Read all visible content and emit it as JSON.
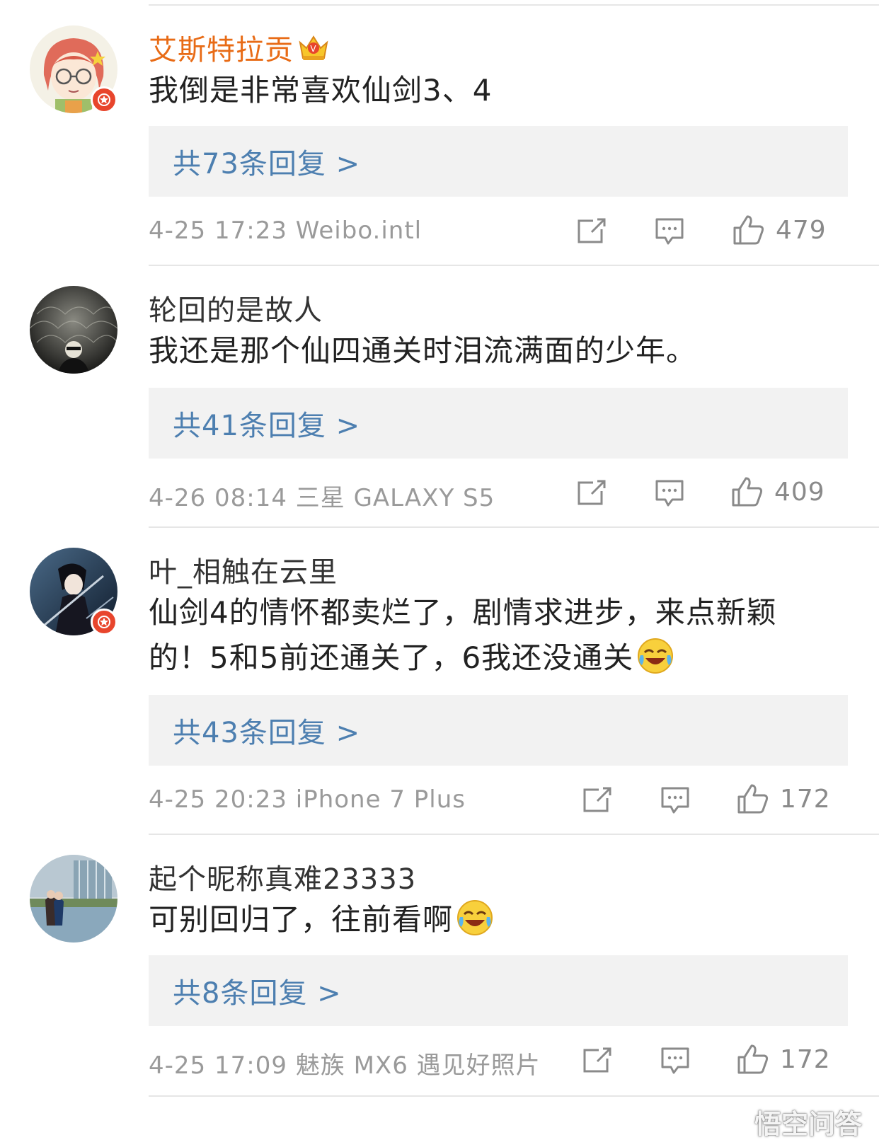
{
  "comments": [
    {
      "username": "艾斯特拉贡",
      "text": "我倒是非常喜欢仙剑3、4",
      "text_line2": "",
      "replies_label": "共73条回复 >",
      "meta": "4-25 17:23 Weibo.intl",
      "likes": "479"
    },
    {
      "username": "轮回的是故人",
      "text": "我还是那个仙四通关时泪流满面的少年。",
      "text_line2": "",
      "replies_label": "共41条回复 >",
      "meta": "4-26 08:14  三星 GALAXY S5",
      "likes": "409"
    },
    {
      "username": "叶_相触在云里",
      "text": "仙剑4的情怀都卖烂了，剧情求进步，来点新颖",
      "text_line2": "的！5和5前还通关了，6我还没通关",
      "replies_label": "共43条回复 >",
      "meta": "4-25 20:23 iPhone 7 Plus",
      "likes": "172"
    },
    {
      "username": "起个昵称真难23333",
      "text": "可别回归了，往前看啊",
      "text_line2": "",
      "replies_label": "共8条回复 >",
      "meta": "4-25 17:09 魅族 MX6 遇见好照片",
      "likes": "172"
    }
  ],
  "icons": {
    "repost": "repost-icon",
    "comment": "comment-icon",
    "like": "thumbs-up-icon",
    "vip": "crown-icon",
    "verified": "verified-badge-icon",
    "emoji": "laugh-cry-emoji"
  },
  "colors": {
    "vip_username": "#e86b16",
    "reply_link": "#4d7fb0",
    "meta_text": "#9a9a9a",
    "reply_box": "#f2f2f2",
    "verified_badge": "#e8452c"
  },
  "watermark": {
    "label": "悟空问答"
  }
}
